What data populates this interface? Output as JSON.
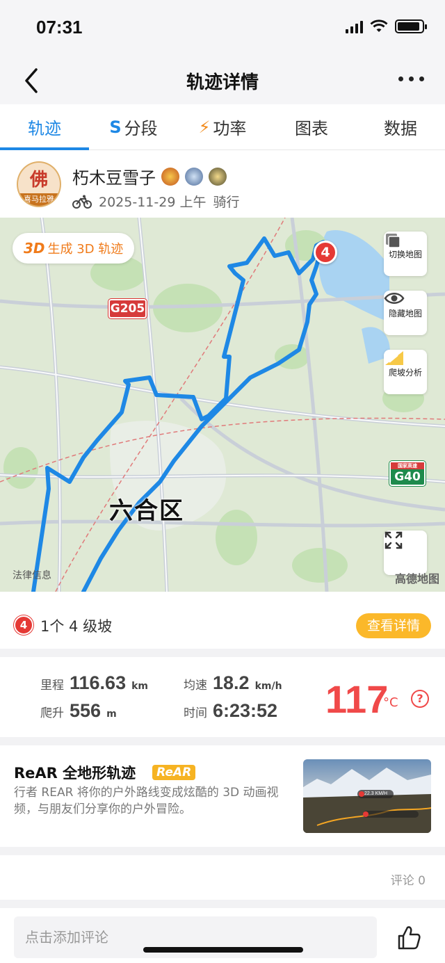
{
  "status": {
    "time": "07:31"
  },
  "nav": {
    "title": "轨迹详情"
  },
  "tabs": [
    {
      "label": "轨迹",
      "icon": ""
    },
    {
      "label": "分段",
      "icon": "S"
    },
    {
      "label": "功率",
      "icon": "⚡"
    },
    {
      "label": "图表",
      "icon": ""
    },
    {
      "label": "数据",
      "icon": ""
    }
  ],
  "profile": {
    "avatar_char": "佛",
    "avatar_caption": "喜马拉雅",
    "name": "朽木豆雪子",
    "date": "2025-11-29 上午",
    "sport": "骑行"
  },
  "map": {
    "btn_3d_prefix": "3D",
    "btn_3d_label": "生成 3D 轨迹",
    "btn_switch": "切换地图",
    "btn_hide": "隐藏地图",
    "btn_climb": "爬坡分析",
    "district": "六合区",
    "hwy_g205": "G205",
    "hwy_g40": "G40",
    "hwy_g40_top": "国家高速",
    "legal": "法律信息",
    "provider": "高德地图",
    "pin": "4",
    "route_color": "#1e88e5"
  },
  "climb": {
    "badge": "4",
    "text": "1个 4 级坡",
    "button": "查看详情"
  },
  "stats": {
    "distance_label": "里程",
    "distance_value": "116.63",
    "distance_unit": "km",
    "speed_label": "均速",
    "speed_value": "18.2",
    "speed_unit": "km/h",
    "elev_label": "爬升",
    "elev_value": "556",
    "elev_unit": "m",
    "time_label": "时间",
    "time_value": "6:23:52",
    "temp_value": "117",
    "temp_unit": "°C",
    "help": "?"
  },
  "rear": {
    "title": "ReAR 全地形轨迹",
    "tag": "ReAR",
    "desc": "行者 REAR 将你的户外路线变成炫酷的 3D 动画视频，与朋友们分享你的户外冒险。",
    "thumb_speed": "22.3 KM/H"
  },
  "comments": {
    "count_label": "评论 0"
  },
  "bottom": {
    "placeholder": "点击添加评论"
  }
}
